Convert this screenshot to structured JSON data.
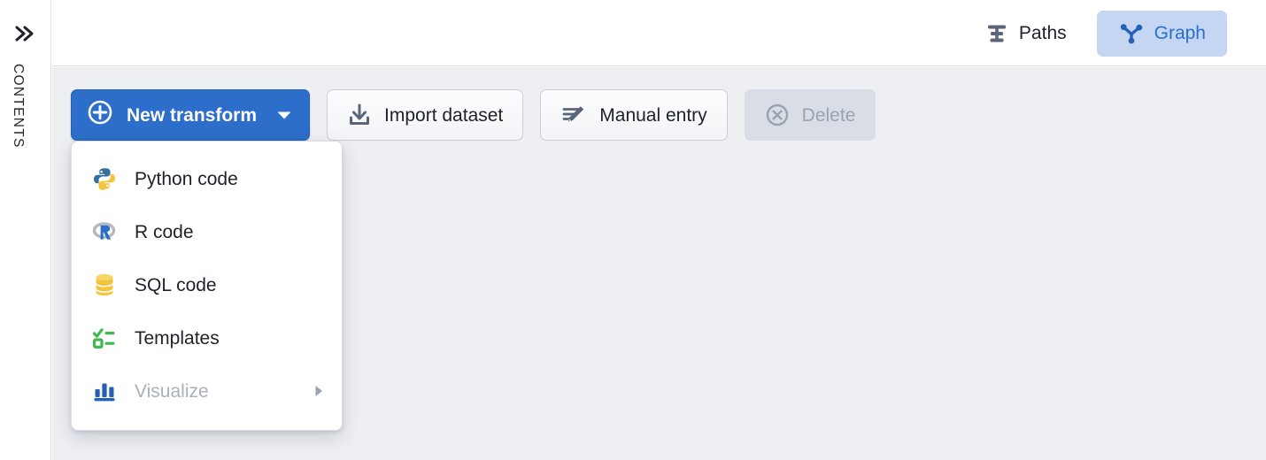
{
  "sidebar": {
    "expand_icon": "chevrons-right-icon",
    "label": "CONTENTS"
  },
  "header": {
    "tabs": [
      {
        "label": "Paths",
        "icon": "paths-align-icon",
        "selected": false
      },
      {
        "label": "Graph",
        "icon": "node-graph-icon",
        "selected": true
      }
    ]
  },
  "toolbar": {
    "new_transform": {
      "label": "New transform",
      "icon": "plus-circle-icon",
      "caret_icon": "caret-down-icon",
      "expanded": true
    },
    "buttons": [
      {
        "label": "Import dataset",
        "icon": "download-icon",
        "disabled": false
      },
      {
        "label": "Manual entry",
        "icon": "pencil-lines-icon",
        "disabled": false
      },
      {
        "label": "Delete",
        "icon": "x-circle-icon",
        "disabled": true
      }
    ]
  },
  "menu": {
    "items": [
      {
        "label": "Python code",
        "icon": "python-logo-icon",
        "disabled": false,
        "submenu": false
      },
      {
        "label": "R code",
        "icon": "r-logo-icon",
        "disabled": false,
        "submenu": false
      },
      {
        "label": "SQL code",
        "icon": "database-icon",
        "disabled": false,
        "submenu": false
      },
      {
        "label": "Templates",
        "icon": "checklist-icon",
        "disabled": false,
        "submenu": false
      },
      {
        "label": "Visualize",
        "icon": "bar-chart-icon",
        "disabled": true,
        "submenu": true
      }
    ],
    "submenu_arrow_icon": "caret-right-icon"
  },
  "colors": {
    "accent_blue": "#2c6ec9",
    "tab_selected_bg": "#c4d6f2",
    "toolbar_bg": "#edeff3",
    "icon_slate": "#5a6579",
    "disabled_text": "#9aa3b2",
    "python_blue": "#356f9e",
    "python_yellow": "#f2c53d",
    "r_gray": "#b5b9bf",
    "sql_gold": "#f2c53d",
    "templates_green": "#3fb950"
  }
}
